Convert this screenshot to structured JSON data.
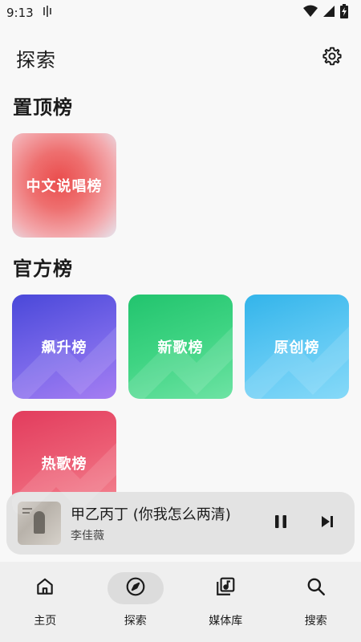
{
  "status_bar": {
    "time": "9:13",
    "icons": [
      "audio-wave-icon",
      "wifi-icon",
      "signal-icon",
      "battery-charging-icon"
    ]
  },
  "header": {
    "title": "探索",
    "settings_icon": "gear-icon"
  },
  "sections": {
    "pinned": {
      "title": "置顶榜",
      "cards": [
        {
          "label": "中文说唱榜"
        }
      ]
    },
    "official": {
      "title": "官方榜",
      "cards": [
        {
          "label": "飙升榜",
          "color": "#5f55e0"
        },
        {
          "label": "新歌榜",
          "color": "#2fcb77"
        },
        {
          "label": "原创榜",
          "color": "#4cbeef"
        },
        {
          "label": "热歌榜",
          "color": "#e84b66"
        }
      ]
    }
  },
  "player": {
    "title": "甲乙丙丁 (你我怎么两清)",
    "artist": "李佳薇",
    "controls": [
      "pause-icon",
      "skip-next-icon"
    ]
  },
  "nav": {
    "items": [
      {
        "label": "主页",
        "icon": "home-icon"
      },
      {
        "label": "探索",
        "icon": "compass-icon",
        "active": true
      },
      {
        "label": "媒体库",
        "icon": "music-library-icon"
      },
      {
        "label": "搜索",
        "icon": "search-icon"
      }
    ]
  }
}
